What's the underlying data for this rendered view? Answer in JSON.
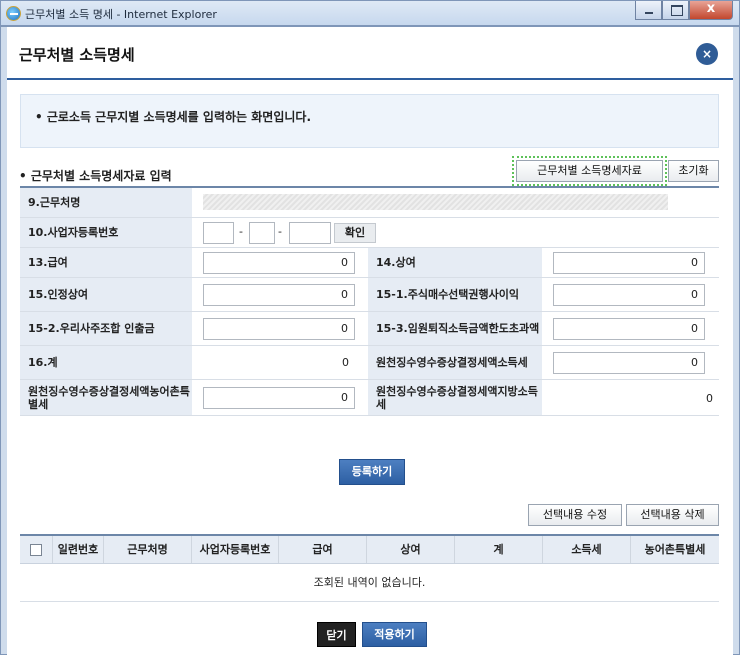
{
  "window": {
    "title": "근무처별 소득 명세 - Internet Explorer"
  },
  "popup": {
    "title": "근무처별 소득명세",
    "close_glyph": "×"
  },
  "notice": "• 근로소득 근무지별 소득명세를 입력하는 화면입니다.",
  "section": {
    "title": "• 근무처별 소득명세자료 입력",
    "data_button": "근무처별 소득명세자료",
    "reset_button": "초기화"
  },
  "form": {
    "workplace_label": "9.근무처명",
    "biz_no_label": "10.사업자등록번호",
    "biz_dash": "-",
    "check_button": "확인",
    "salary_label": "13.급여",
    "salary_value": "0",
    "bonus_label": "14.상여",
    "bonus_value": "0",
    "deemed_bonus_label": "15.인정상여",
    "deemed_bonus_value": "0",
    "stock_option_label": "15-1.주식매수선택권행사이익",
    "stock_option_value": "0",
    "esop_label": "15-2.우리사주조합 인출금",
    "esop_value": "0",
    "retire_label": "15-3.임원퇴직소득금액한도초과액",
    "retire_value": "0",
    "total_label": "16.계",
    "total_value": "0",
    "income_tax_label": "원천징수영수증상결정세액소득세",
    "income_tax_value": "0",
    "rural_tax_label": "원천징수영수증상결정세액농어촌특별세",
    "rural_tax_value": "0",
    "local_tax_label": "원천징수영수증상결정세액지방소득세",
    "local_tax_value": "0"
  },
  "register_button": "등록하기",
  "edit_button": "선택내용 수정",
  "delete_button": "선택내용 삭제",
  "table": {
    "columns": [
      "일련번호",
      "근무처명",
      "사업자등록번호",
      "급여",
      "상여",
      "계",
      "소득세",
      "농어촌특별세"
    ],
    "empty_message": "조회된 내역이 없습니다."
  },
  "close_button": "닫기",
  "apply_button": "적용하기"
}
